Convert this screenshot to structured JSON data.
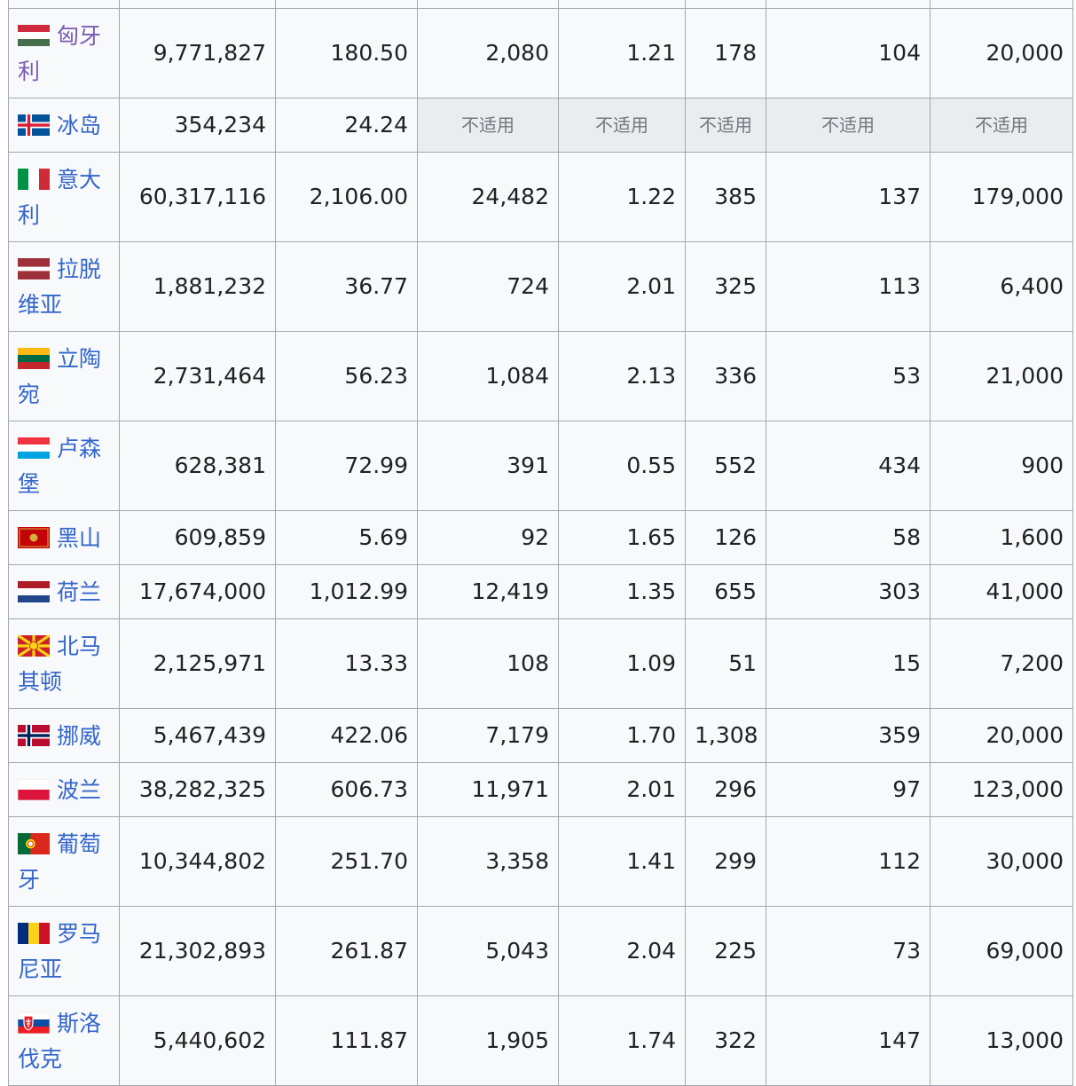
{
  "rows": [
    {
      "country": "匈牙利",
      "flag": "hungary-flag",
      "visited": true,
      "tall": true,
      "values": [
        "9,771,827",
        "180.50",
        "2,080",
        "1.21",
        "178",
        "104",
        "20,000"
      ]
    },
    {
      "country": "冰岛",
      "flag": "iceland-flag",
      "visited": false,
      "tall": false,
      "values": [
        "354,234",
        "24.24",
        "不适用",
        "不适用",
        "不适用",
        "不适用",
        "不适用"
      ]
    },
    {
      "country": "意大利",
      "flag": "italy-flag",
      "visited": false,
      "tall": true,
      "values": [
        "60,317,116",
        "2,106.00",
        "24,482",
        "1.22",
        "385",
        "137",
        "179,000"
      ]
    },
    {
      "country": "拉脱维亚",
      "flag": "latvia-flag",
      "visited": false,
      "tall": true,
      "values": [
        "1,881,232",
        "36.77",
        "724",
        "2.01",
        "325",
        "113",
        "6,400"
      ]
    },
    {
      "country": "立陶宛",
      "flag": "lithuania-flag",
      "visited": false,
      "tall": true,
      "values": [
        "2,731,464",
        "56.23",
        "1,084",
        "2.13",
        "336",
        "53",
        "21,000"
      ]
    },
    {
      "country": "卢森堡",
      "flag": "luxembourg-flag",
      "visited": false,
      "tall": true,
      "values": [
        "628,381",
        "72.99",
        "391",
        "0.55",
        "552",
        "434",
        "900"
      ]
    },
    {
      "country": "黑山",
      "flag": "montenegro-flag",
      "visited": false,
      "tall": false,
      "values": [
        "609,859",
        "5.69",
        "92",
        "1.65",
        "126",
        "58",
        "1,600"
      ]
    },
    {
      "country": "荷兰",
      "flag": "netherlands-flag",
      "visited": false,
      "tall": false,
      "values": [
        "17,674,000",
        "1,012.99",
        "12,419",
        "1.35",
        "655",
        "303",
        "41,000"
      ]
    },
    {
      "country": "北马其顿",
      "flag": "north-macedonia-flag",
      "visited": false,
      "tall": true,
      "values": [
        "2,125,971",
        "13.33",
        "108",
        "1.09",
        "51",
        "15",
        "7,200"
      ]
    },
    {
      "country": "挪威",
      "flag": "norway-flag",
      "visited": false,
      "tall": false,
      "values": [
        "5,467,439",
        "422.06",
        "7,179",
        "1.70",
        "1,308",
        "359",
        "20,000"
      ]
    },
    {
      "country": "波兰",
      "flag": "poland-flag",
      "visited": false,
      "tall": false,
      "values": [
        "38,282,325",
        "606.73",
        "11,971",
        "2.01",
        "296",
        "97",
        "123,000"
      ]
    },
    {
      "country": "葡萄牙",
      "flag": "portugal-flag",
      "visited": false,
      "tall": true,
      "values": [
        "10,344,802",
        "251.70",
        "3,358",
        "1.41",
        "299",
        "112",
        "30,000"
      ]
    },
    {
      "country": "罗马尼亚",
      "flag": "romania-flag",
      "visited": false,
      "tall": true,
      "values": [
        "21,302,893",
        "261.87",
        "5,043",
        "2.04",
        "225",
        "73",
        "69,000"
      ]
    },
    {
      "country": "斯洛伐克",
      "flag": "slovakia-flag",
      "visited": false,
      "tall": true,
      "values": [
        "5,440,602",
        "111.87",
        "1,905",
        "1.74",
        "322",
        "147",
        "13,000"
      ]
    }
  ],
  "na_label": "不适用",
  "colors": {
    "link": "#3366cc",
    "visited_link": "#795cb2",
    "na_bg": "#eaecf0",
    "border": "#a2a9b1"
  }
}
